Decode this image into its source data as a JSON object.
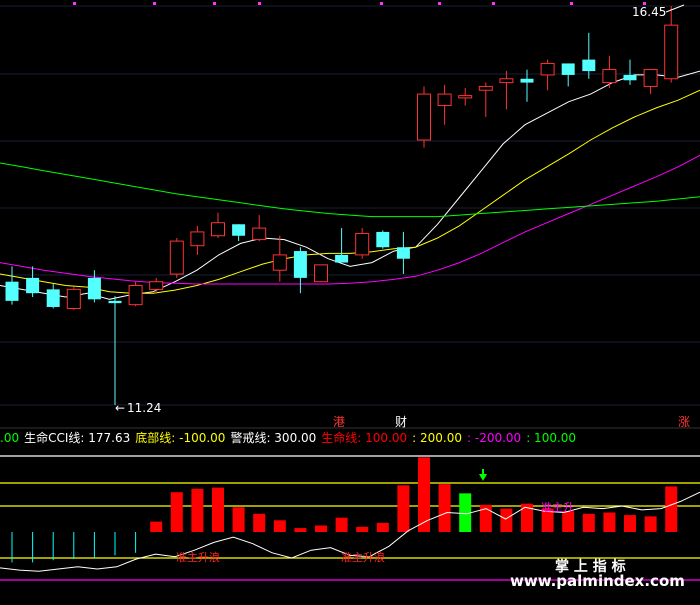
{
  "chart_data": [
    {
      "type": "candlestick",
      "title": "",
      "annotations": {
        "high_label": "16.45",
        "low_label": "11.24",
        "low_marker_prefix": "←",
        "tags": [
          "港",
          "财",
          "涨"
        ]
      },
      "candles": [
        {
          "o": 12.85,
          "h": 13.05,
          "l": 12.55,
          "c": 12.6
        },
        {
          "o": 12.9,
          "h": 13.05,
          "l": 12.65,
          "c": 12.7
        },
        {
          "o": 12.75,
          "h": 12.82,
          "l": 12.5,
          "c": 12.52
        },
        {
          "o": 12.5,
          "h": 12.78,
          "l": 12.48,
          "c": 12.75
        },
        {
          "o": 12.9,
          "h": 13.0,
          "l": 12.58,
          "c": 12.62
        },
        {
          "o": 12.6,
          "h": 12.66,
          "l": 11.24,
          "c": 12.57
        },
        {
          "o": 12.55,
          "h": 12.85,
          "l": 12.53,
          "c": 12.8
        },
        {
          "o": 12.75,
          "h": 12.9,
          "l": 12.7,
          "c": 12.85
        },
        {
          "o": 12.95,
          "h": 13.42,
          "l": 12.9,
          "c": 13.38
        },
        {
          "o": 13.32,
          "h": 13.58,
          "l": 13.2,
          "c": 13.5
        },
        {
          "o": 13.45,
          "h": 13.75,
          "l": 13.42,
          "c": 13.62
        },
        {
          "o": 13.6,
          "h": 13.56,
          "l": 13.38,
          "c": 13.45
        },
        {
          "o": 13.4,
          "h": 13.72,
          "l": 13.38,
          "c": 13.55
        },
        {
          "o": 13.0,
          "h": 13.45,
          "l": 12.85,
          "c": 13.2
        },
        {
          "o": 13.25,
          "h": 13.3,
          "l": 12.7,
          "c": 12.9
        },
        {
          "o": 12.85,
          "h": 12.97,
          "l": 12.9,
          "c": 13.07
        },
        {
          "o": 13.2,
          "h": 13.55,
          "l": 13.15,
          "c": 13.1
        },
        {
          "o": 13.2,
          "h": 13.55,
          "l": 13.15,
          "c": 13.48
        },
        {
          "o": 13.5,
          "h": 13.52,
          "l": 13.28,
          "c": 13.3
        },
        {
          "o": 13.3,
          "h": 13.5,
          "l": 12.95,
          "c": 13.15
        },
        {
          "o": 14.7,
          "h": 15.4,
          "l": 14.6,
          "c": 15.3
        },
        {
          "o": 15.15,
          "h": 15.42,
          "l": 14.9,
          "c": 15.3
        },
        {
          "o": 15.25,
          "h": 15.38,
          "l": 15.15,
          "c": 15.28
        },
        {
          "o": 15.35,
          "h": 15.45,
          "l": 15.0,
          "c": 15.4
        },
        {
          "o": 15.45,
          "h": 15.6,
          "l": 15.1,
          "c": 15.5
        },
        {
          "o": 15.5,
          "h": 15.62,
          "l": 15.2,
          "c": 15.45
        },
        {
          "o": 15.55,
          "h": 15.75,
          "l": 15.35,
          "c": 15.7
        },
        {
          "o": 15.7,
          "h": 15.7,
          "l": 15.4,
          "c": 15.55
        },
        {
          "o": 15.75,
          "h": 16.1,
          "l": 15.5,
          "c": 15.6
        },
        {
          "o": 15.45,
          "h": 15.8,
          "l": 15.38,
          "c": 15.62
        },
        {
          "o": 15.55,
          "h": 15.75,
          "l": 15.42,
          "c": 15.48
        },
        {
          "o": 15.4,
          "h": 15.55,
          "l": 15.3,
          "c": 15.62
        },
        {
          "o": 15.5,
          "h": 16.45,
          "l": 15.45,
          "c": 16.2
        }
      ],
      "moving_averages": [
        {
          "color": "#ffffff",
          "values": [
            12.8,
            12.75,
            12.7,
            12.65,
            12.7,
            12.62,
            12.68,
            12.72,
            12.85,
            13.0,
            13.2,
            13.35,
            13.42,
            13.4,
            13.3,
            13.15,
            13.05,
            13.1,
            13.25,
            13.3,
            13.6,
            13.95,
            14.3,
            14.65,
            14.9,
            15.05,
            15.2,
            15.3,
            15.45,
            15.55,
            15.55,
            15.52,
            15.6
          ]
        },
        {
          "color": "#ffff00",
          "values": [
            12.95,
            12.9,
            12.85,
            12.8,
            12.78,
            12.72,
            12.7,
            12.7,
            12.74,
            12.8,
            12.88,
            12.98,
            13.08,
            13.15,
            13.2,
            13.22,
            13.22,
            13.24,
            13.28,
            13.3,
            13.42,
            13.58,
            13.78,
            13.98,
            14.18,
            14.35,
            14.52,
            14.7,
            14.86,
            15.0,
            15.12,
            15.22,
            15.35
          ]
        },
        {
          "color": "#ff00ff",
          "values": [
            13.1,
            13.05,
            13.0,
            12.96,
            12.92,
            12.89,
            12.86,
            12.84,
            12.83,
            12.82,
            12.82,
            12.82,
            12.82,
            12.82,
            12.82,
            12.82,
            12.83,
            12.85,
            12.88,
            12.92,
            13.0,
            13.1,
            13.22,
            13.36,
            13.5,
            13.62,
            13.74,
            13.86,
            13.98,
            14.1,
            14.22,
            14.35,
            14.5
          ]
        },
        {
          "color": "#00ff00",
          "values": [
            14.4,
            14.35,
            14.3,
            14.25,
            14.2,
            14.15,
            14.1,
            14.05,
            14.0,
            13.96,
            13.92,
            13.88,
            13.84,
            13.8,
            13.77,
            13.74,
            13.72,
            13.7,
            13.7,
            13.7,
            13.7,
            13.72,
            13.74,
            13.76,
            13.78,
            13.8,
            13.82,
            13.84,
            13.86,
            13.88,
            13.9,
            13.93,
            13.96
          ]
        }
      ]
    },
    {
      "type": "bar",
      "legend": [
        {
          "text": ".00",
          "color": "#00ff00"
        },
        {
          "text": "生命CCI线: 177.63",
          "color": "#ffffff"
        },
        {
          "text": "底部线: -100.00",
          "color": "#ffff00"
        },
        {
          "text": "警戒线: 300.00",
          "color": "#ffffff"
        },
        {
          "text": "生命线: 100.00",
          "color": "#ff0000"
        },
        {
          "text": ": 200.00",
          "color": "#ffff00"
        },
        {
          "text": ": -200.00",
          "color": "#ff00ff"
        },
        {
          "text": ": 100.00",
          "color": "#00ff00"
        }
      ],
      "reference_lines": [
        {
          "value": 300,
          "color": "#ffffff"
        },
        {
          "value": 200,
          "color": "#ffff00"
        },
        {
          "value": 100,
          "color": "#ffff00"
        },
        {
          "value": -100,
          "color": "#ffff00"
        },
        {
          "value": -200,
          "color": "#ff00ff"
        }
      ],
      "cci_line": [
        -145,
        -155,
        -160,
        -150,
        -140,
        -150,
        -140,
        -105,
        -85,
        -95,
        -70,
        -40,
        -20,
        -45,
        -80,
        -100,
        -70,
        -60,
        -90,
        -95,
        -55,
        5,
        45,
        75,
        70,
        90,
        50,
        95,
        80,
        75,
        95,
        90,
        100,
        85,
        90,
        120,
        160
      ],
      "bars": [
        {
          "value": -120,
          "color": "#00ffff"
        },
        {
          "value": -120,
          "color": "#00ffff"
        },
        {
          "value": -110,
          "color": "#00ffff"
        },
        {
          "value": -105,
          "color": "#00ffff"
        },
        {
          "value": -100,
          "color": "#00ffff"
        },
        {
          "value": -90,
          "color": "#00ffff"
        },
        {
          "value": -80,
          "color": "#00ffff"
        },
        {
          "value": 40,
          "color": "#ff0000"
        },
        {
          "value": 160,
          "color": "#ff0000"
        },
        {
          "value": 175,
          "color": "#ff0000"
        },
        {
          "value": 180,
          "color": "#ff0000"
        },
        {
          "value": 95,
          "color": "#ff0000"
        },
        {
          "value": 70,
          "color": "#ff0000"
        },
        {
          "value": 45,
          "color": "#ff0000"
        },
        {
          "value": 15,
          "color": "#ff0000"
        },
        {
          "value": 25,
          "color": "#ff0000"
        },
        {
          "value": 55,
          "color": "#ff0000"
        },
        {
          "value": 20,
          "color": "#ff0000"
        },
        {
          "value": 35,
          "color": "#ff0000"
        },
        {
          "value": 190,
          "color": "#ff0000"
        },
        {
          "value": 295,
          "color": "#ff0000"
        },
        {
          "value": 195,
          "color": "#ff0000"
        },
        {
          "value": 155,
          "color": "#00ff00"
        },
        {
          "value": 105,
          "color": "#ff0000"
        },
        {
          "value": 90,
          "color": "#ff0000"
        },
        {
          "value": 110,
          "color": "#ff0000"
        },
        {
          "value": 90,
          "color": "#ff0000"
        },
        {
          "value": 80,
          "color": "#ff0000"
        },
        {
          "value": 70,
          "color": "#ff0000"
        },
        {
          "value": 75,
          "color": "#ff0000"
        },
        {
          "value": 65,
          "color": "#ff0000"
        },
        {
          "value": 60,
          "color": "#ff0000"
        },
        {
          "value": 185,
          "color": "#ff0000"
        }
      ],
      "annotations": {
        "signal_left": "准主升浪",
        "signal_mid": "准主升浪",
        "signal_right": "准主升",
        "brand": "掌 上 指 标",
        "website": "www.palmindex.com"
      }
    }
  ]
}
